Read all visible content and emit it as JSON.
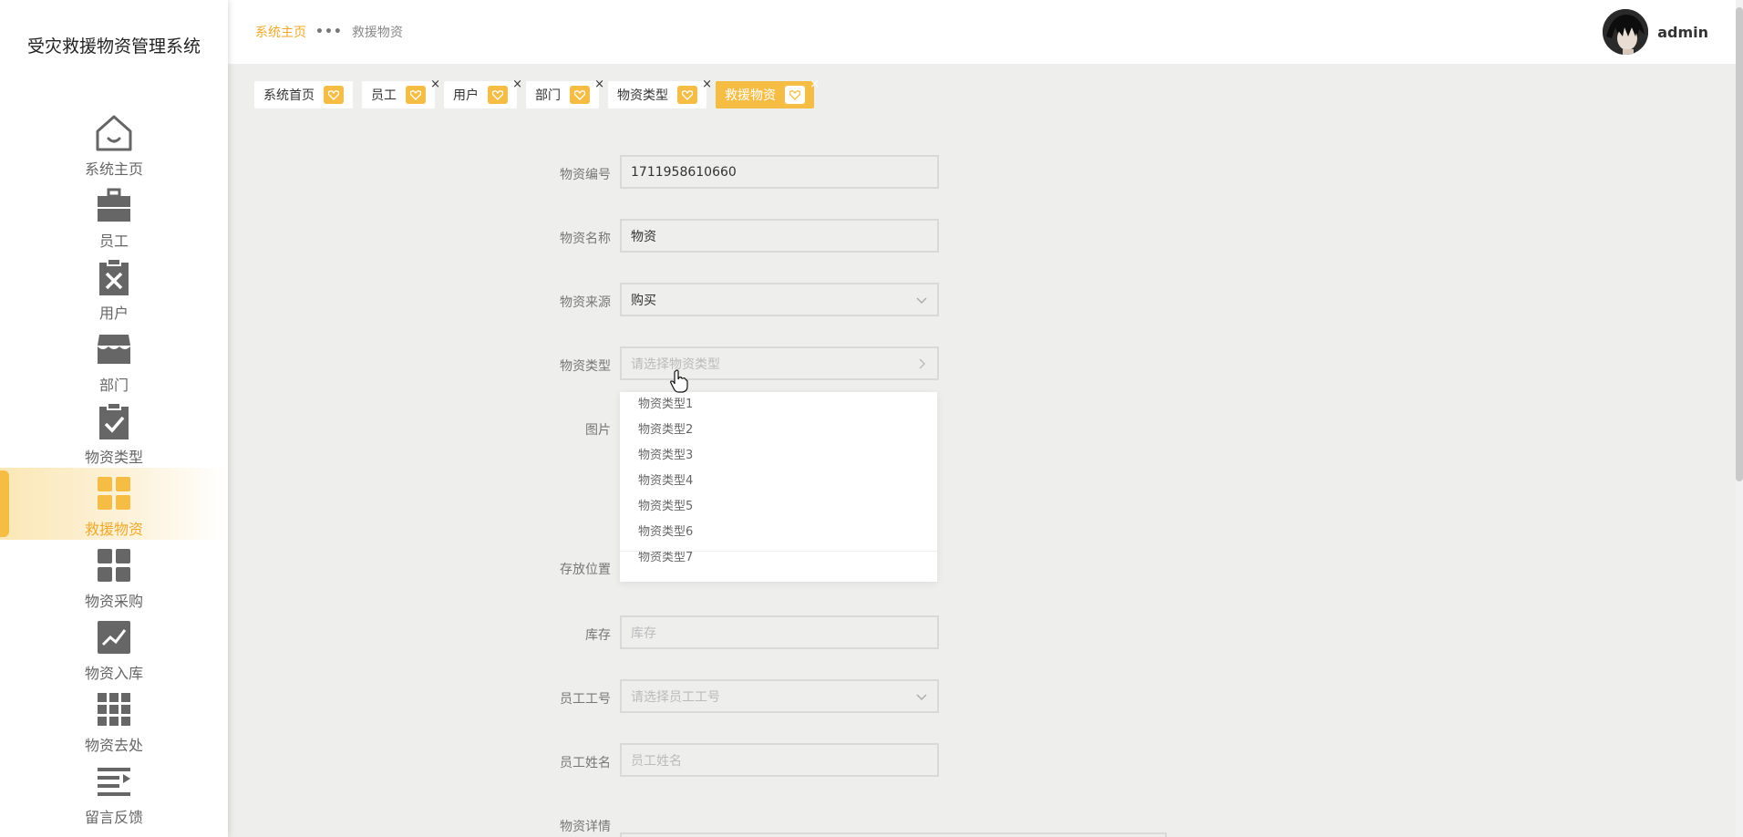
{
  "app": {
    "brand": "受灾救援物资管理系统"
  },
  "sidebar": {
    "items": [
      {
        "label": "系统主页",
        "icon": "home-icon"
      },
      {
        "label": "员工",
        "icon": "briefcase-icon"
      },
      {
        "label": "用户",
        "icon": "clipboard-x-icon"
      },
      {
        "label": "部门",
        "icon": "store-icon"
      },
      {
        "label": "物资类型",
        "icon": "clipboard-check-icon"
      },
      {
        "label": "救援物资",
        "icon": "grid-icon",
        "active": true
      },
      {
        "label": "物资采购",
        "icon": "grid-icon"
      },
      {
        "label": "物资入库",
        "icon": "chart-line-icon"
      },
      {
        "label": "物资去处",
        "icon": "apps-grid-icon"
      },
      {
        "label": "留言反馈",
        "icon": "list-icon"
      }
    ]
  },
  "header": {
    "breadcrumb": {
      "home": "系统主页",
      "separator": "•••",
      "current": "救援物资"
    },
    "user": {
      "name": "admin"
    }
  },
  "tabs": [
    {
      "label": "系统首页",
      "closable": false
    },
    {
      "label": "员工",
      "closable": true
    },
    {
      "label": "用户",
      "closable": true
    },
    {
      "label": "部门",
      "closable": true
    },
    {
      "label": "物资类型",
      "closable": true
    },
    {
      "label": "救援物资",
      "closable": true,
      "active": true
    }
  ],
  "form": {
    "code": {
      "label": "物资编号",
      "value": "1711958610660"
    },
    "name": {
      "label": "物资名称",
      "value": "物资"
    },
    "source": {
      "label": "物资来源",
      "value": "购买"
    },
    "type": {
      "label": "物资类型",
      "placeholder": "请选择物资类型"
    },
    "image": {
      "label": "图片"
    },
    "location": {
      "label": "存放位置"
    },
    "stock": {
      "label": "库存",
      "placeholder": "库存"
    },
    "emp_no": {
      "label": "员工工号",
      "placeholder": "请选择员工工号"
    },
    "emp_name": {
      "label": "员工姓名",
      "placeholder": "员工姓名"
    },
    "detail": {
      "label": "物资详情"
    }
  },
  "dropdown": {
    "options": [
      "物资类型1",
      "物资类型2",
      "物资类型3",
      "物资类型4",
      "物资类型5",
      "物资类型6",
      "物资类型7"
    ]
  },
  "colors": {
    "accent": "#f6bd45",
    "accent_text": "#f0a92a",
    "icon_gray": "#666666"
  }
}
